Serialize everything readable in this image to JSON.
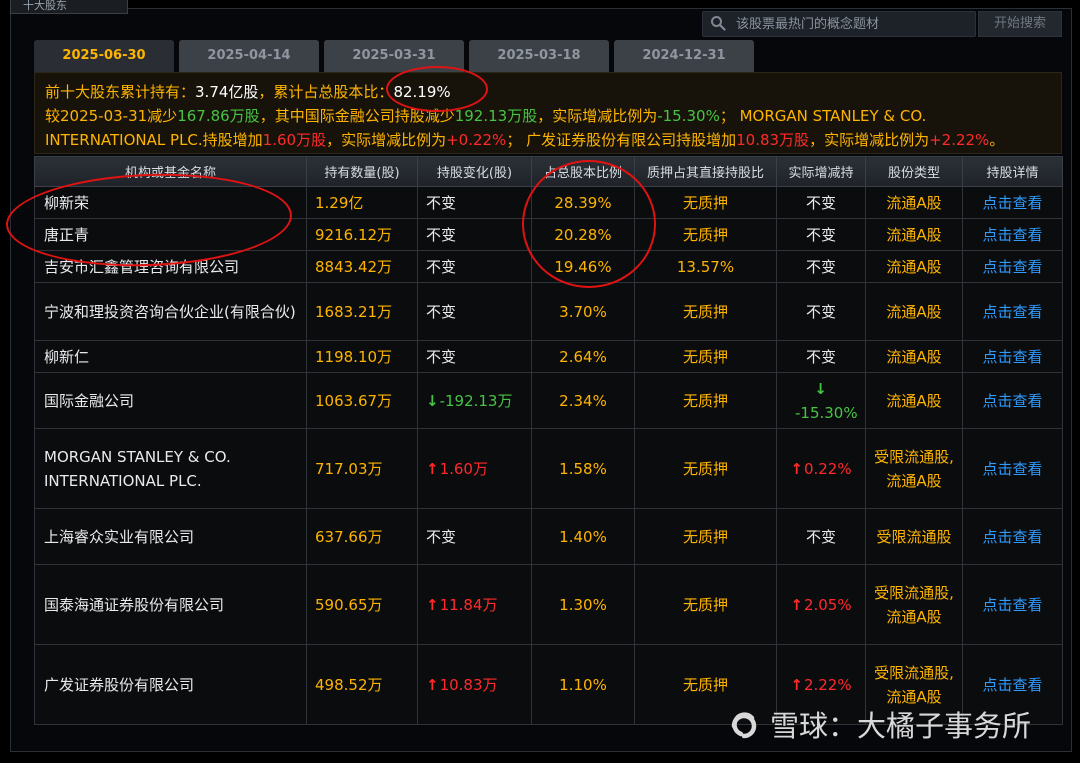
{
  "window": {
    "corner_title": "十大股东"
  },
  "search": {
    "placeholder": "该股票最热门的概念题材",
    "button_label": "开始搜索",
    "icon": "search-icon"
  },
  "tabs": [
    {
      "label": "2025-06-30",
      "active": true
    },
    {
      "label": "2025-04-14",
      "active": false
    },
    {
      "label": "2025-03-31",
      "active": false
    },
    {
      "label": "2025-03-18",
      "active": false
    },
    {
      "label": "2024-12-31",
      "active": false
    }
  ],
  "summary": {
    "line1_prefix": "前十大股东累计持有：",
    "line1_total": "3.74亿股",
    "line1_mid": "，累计占总股本比：",
    "line1_ratio": "82.19%",
    "line2_a": "较2025-03-31减少",
    "line2_b": "167.86万股",
    "line2_c": "，其中国际金融公司持股减少",
    "line2_d": "192.13万股",
    "line2_e": "，实际增减比例为",
    "line2_f": "-15.30%",
    "line2_g": "；  MORGAN STANLEY & CO.",
    "line3_a": "INTERNATIONAL PLC.持股增加",
    "line3_b": "1.60万股",
    "line3_c": "，实际增减比例为",
    "line3_d": "+0.22%",
    "line3_e": "；  广发证券股份有限公司持股增加",
    "line3_f": "10.83万股",
    "line3_g": "，实际增减比例为",
    "line3_h": "+2.22%",
    "line3_i": "。"
  },
  "table": {
    "headers": [
      "机构或基金名称",
      "持有数量(股)",
      "持股变化(股)",
      "占总股本比例",
      "质押占其直接持股比",
      "实际增减持",
      "股份类型",
      "持股详情"
    ],
    "rows": [
      {
        "name": "柳新荣",
        "qty": "1.29亿",
        "change": "不变",
        "change_dir": "none",
        "ratio": "28.39%",
        "pledge": "无质押",
        "actual": "不变",
        "actual_dir": "none",
        "type": "流通A股",
        "detail": "点击查看"
      },
      {
        "name": "唐正青",
        "qty": "9216.12万",
        "change": "不变",
        "change_dir": "none",
        "ratio": "20.28%",
        "pledge": "无质押",
        "actual": "不变",
        "actual_dir": "none",
        "type": "流通A股",
        "detail": "点击查看"
      },
      {
        "name": "吉安市汇鑫管理咨询有限公司",
        "qty": "8843.42万",
        "change": "不变",
        "change_dir": "none",
        "ratio": "19.46%",
        "pledge": "13.57%",
        "actual": "不变",
        "actual_dir": "none",
        "type": "流通A股",
        "detail": "点击查看"
      },
      {
        "name": "宁波和理投资咨询合伙企业(有限合伙)",
        "qty": "1683.21万",
        "change": "不变",
        "change_dir": "none",
        "ratio": "3.70%",
        "pledge": "无质押",
        "actual": "不变",
        "actual_dir": "none",
        "type": "流通A股",
        "detail": "点击查看"
      },
      {
        "name": "柳新仁",
        "qty": "1198.10万",
        "change": "不变",
        "change_dir": "none",
        "ratio": "2.64%",
        "pledge": "无质押",
        "actual": "不变",
        "actual_dir": "none",
        "type": "流通A股",
        "detail": "点击查看"
      },
      {
        "name": "国际金融公司",
        "qty": "1063.67万",
        "change": "-192.13万",
        "change_dir": "down",
        "ratio": "2.34%",
        "pledge": "无质押",
        "actual": "-15.30%",
        "actual_dir": "down",
        "type": "流通A股",
        "detail": "点击查看"
      },
      {
        "name": "MORGAN STANLEY & CO. INTERNATIONAL PLC.",
        "qty": "717.03万",
        "change": "1.60万",
        "change_dir": "up",
        "ratio": "1.58%",
        "pledge": "无质押",
        "actual": "0.22%",
        "actual_dir": "up",
        "type": "受限流通股,流通A股",
        "detail": "点击查看"
      },
      {
        "name": "上海睿众实业有限公司",
        "qty": "637.66万",
        "change": "不变",
        "change_dir": "none",
        "ratio": "1.40%",
        "pledge": "无质押",
        "actual": "不变",
        "actual_dir": "none",
        "type": "受限流通股",
        "detail": "点击查看"
      },
      {
        "name": "国泰海通证券股份有限公司",
        "qty": "590.65万",
        "change": "11.84万",
        "change_dir": "up",
        "ratio": "1.30%",
        "pledge": "无质押",
        "actual": "2.05%",
        "actual_dir": "up",
        "type": "受限流通股,流通A股",
        "detail": "点击查看"
      },
      {
        "name": "广发证券股份有限公司",
        "qty": "498.52万",
        "change": "10.83万",
        "change_dir": "up",
        "ratio": "1.10%",
        "pledge": "无质押",
        "actual": "2.22%",
        "actual_dir": "up",
        "type": "受限流通股,流通A股",
        "detail": "点击查看"
      }
    ]
  },
  "watermark": {
    "brand": "雪球",
    "separator": "：",
    "author": "大橘子事务所",
    "icon": "snowball-logo-icon"
  },
  "colors": {
    "accent": "#ffb400",
    "up": "#ff2a2a",
    "down": "#46c443",
    "link": "#2e9bff",
    "annotation_ring": "#e01313"
  }
}
